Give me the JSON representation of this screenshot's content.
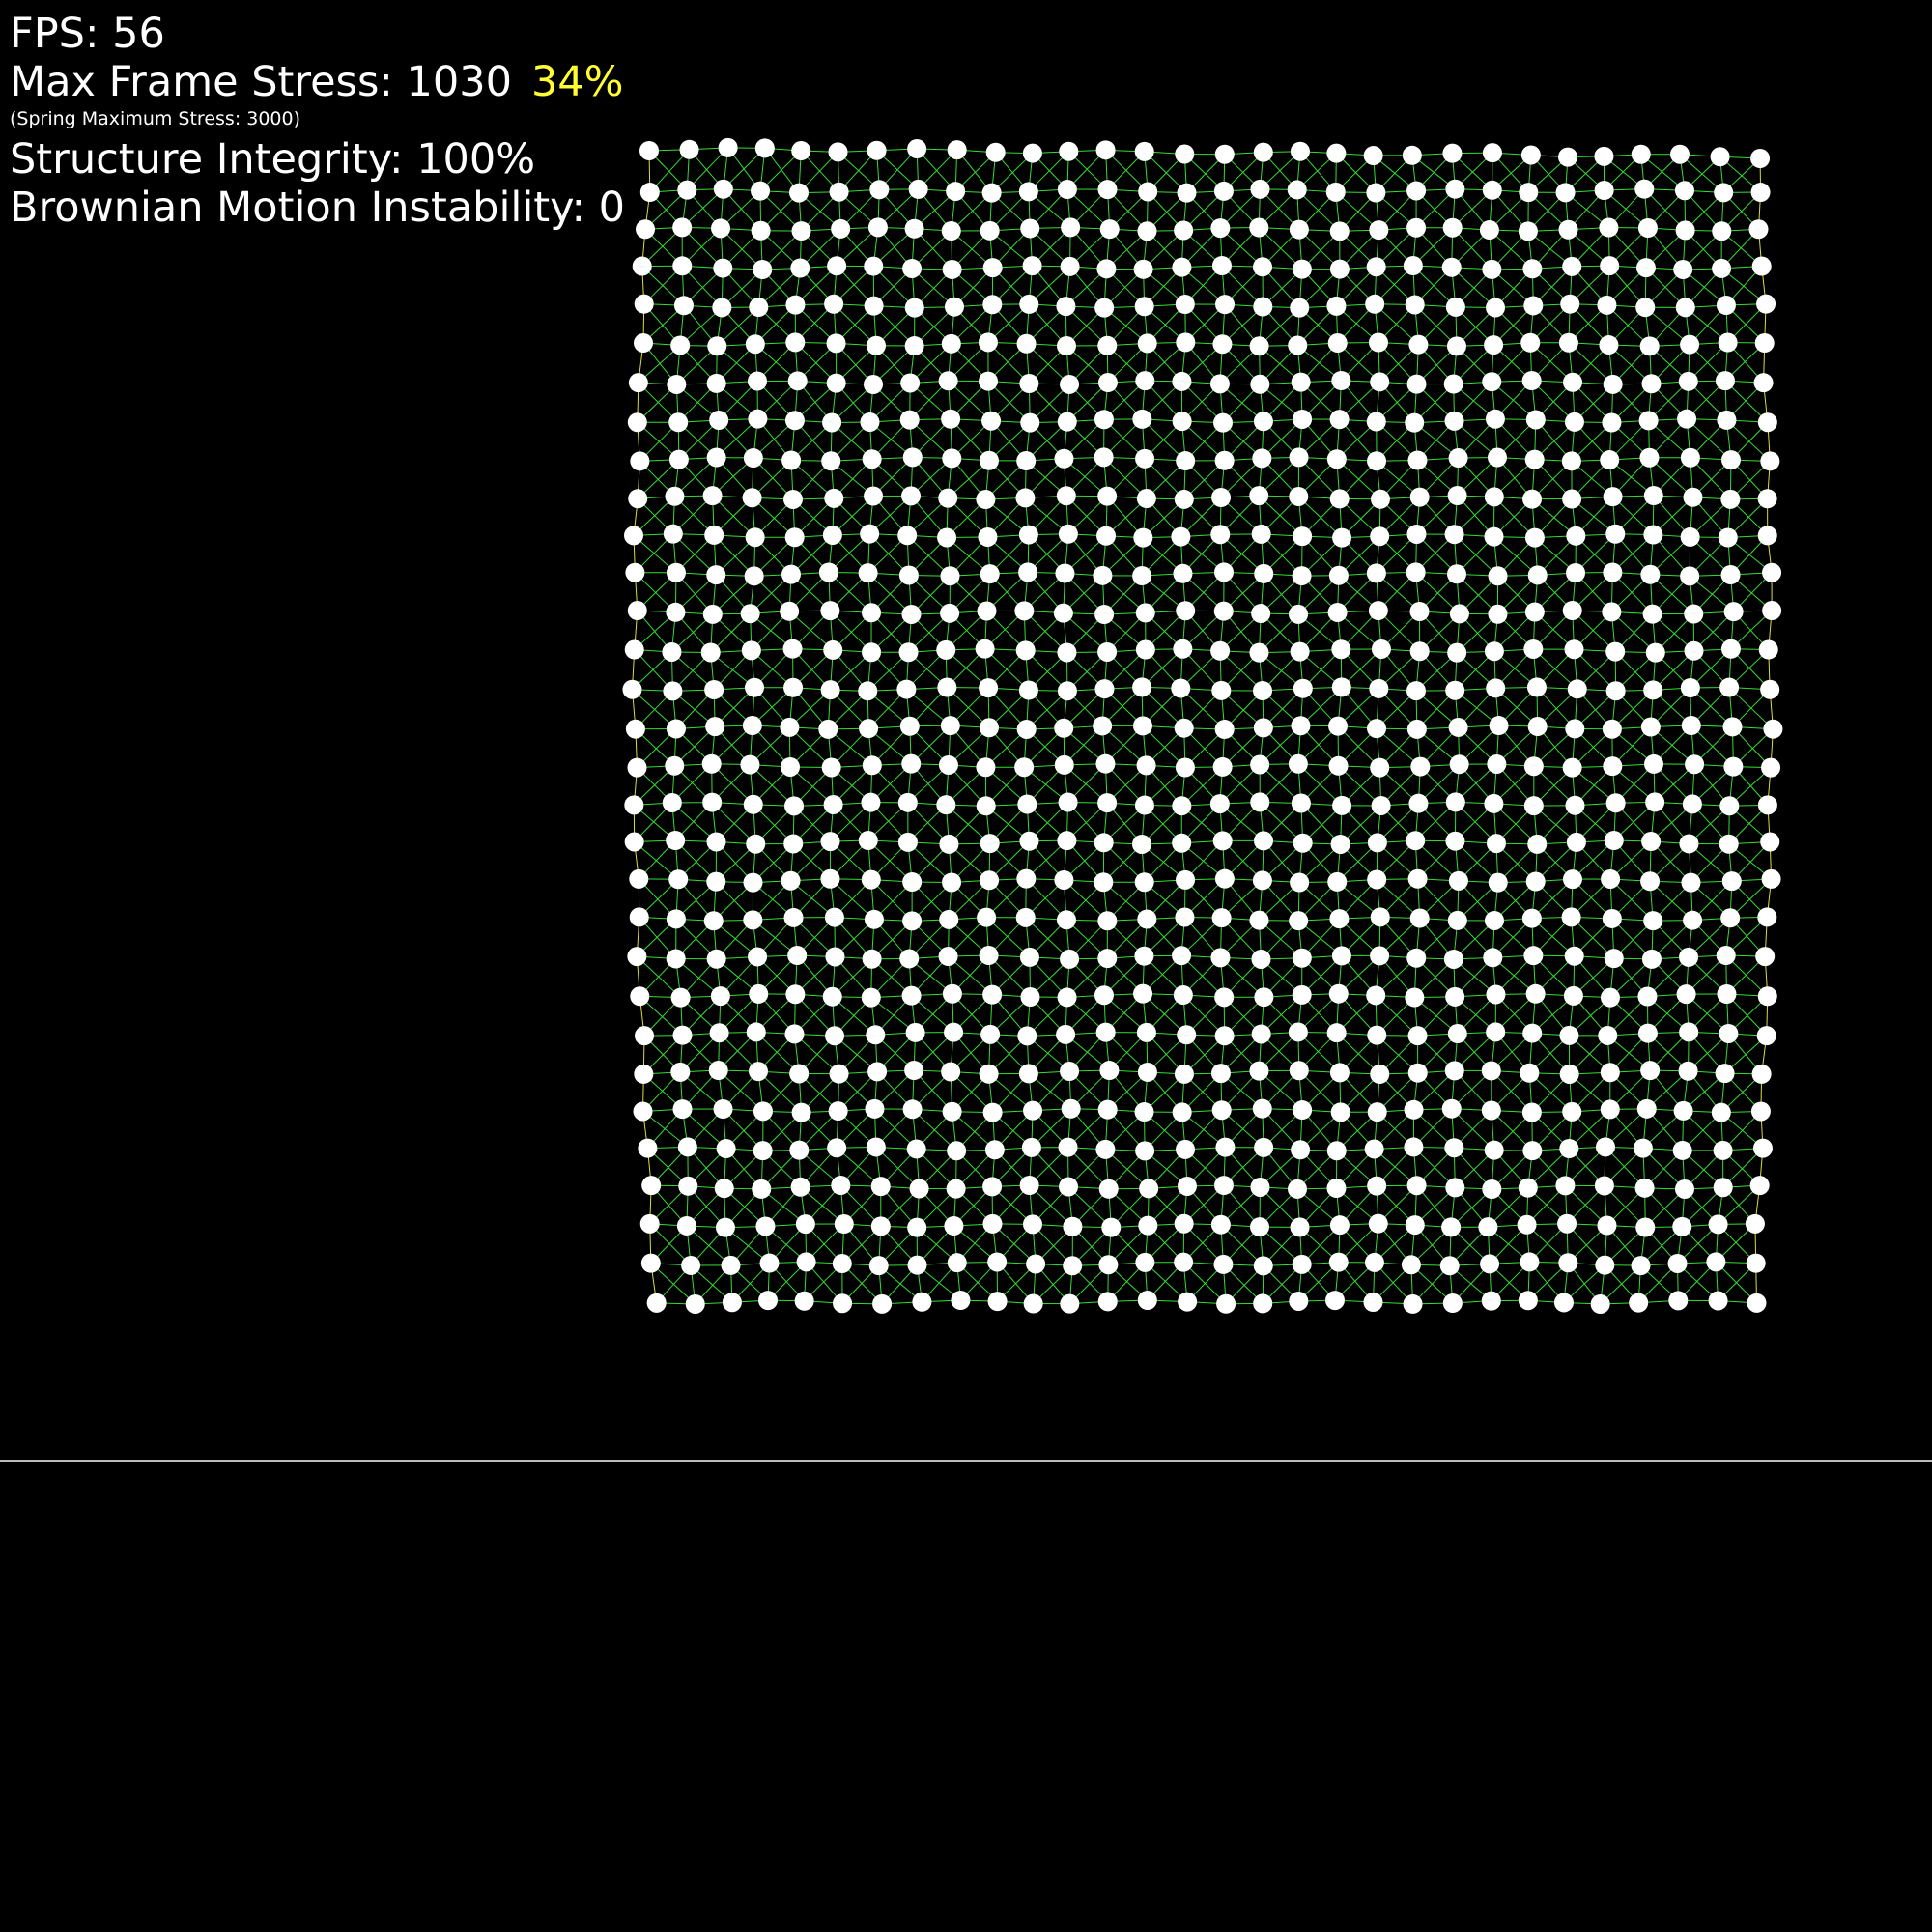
{
  "hud": {
    "fps_text": "FPS: 56",
    "max_frame_stress_label": "Max Frame Stress: 1030",
    "max_frame_stress_percent": "34%",
    "spring_max_stress_text": "(Spring Maximum Stress: 3000)",
    "structure_integrity_text": "Structure Integrity: 100%",
    "brownian_instability_text": "Brownian Motion Instability: 0"
  },
  "simulation": {
    "grid_columns": 30,
    "grid_rows": 31,
    "background_color": "#000000",
    "node_color": "#ffffff",
    "spring_color": "#33dd33",
    "stressed_spring_color": "#dddd33",
    "ground_line_color": "#bbbbbb",
    "warning_color": "#ffff33"
  }
}
